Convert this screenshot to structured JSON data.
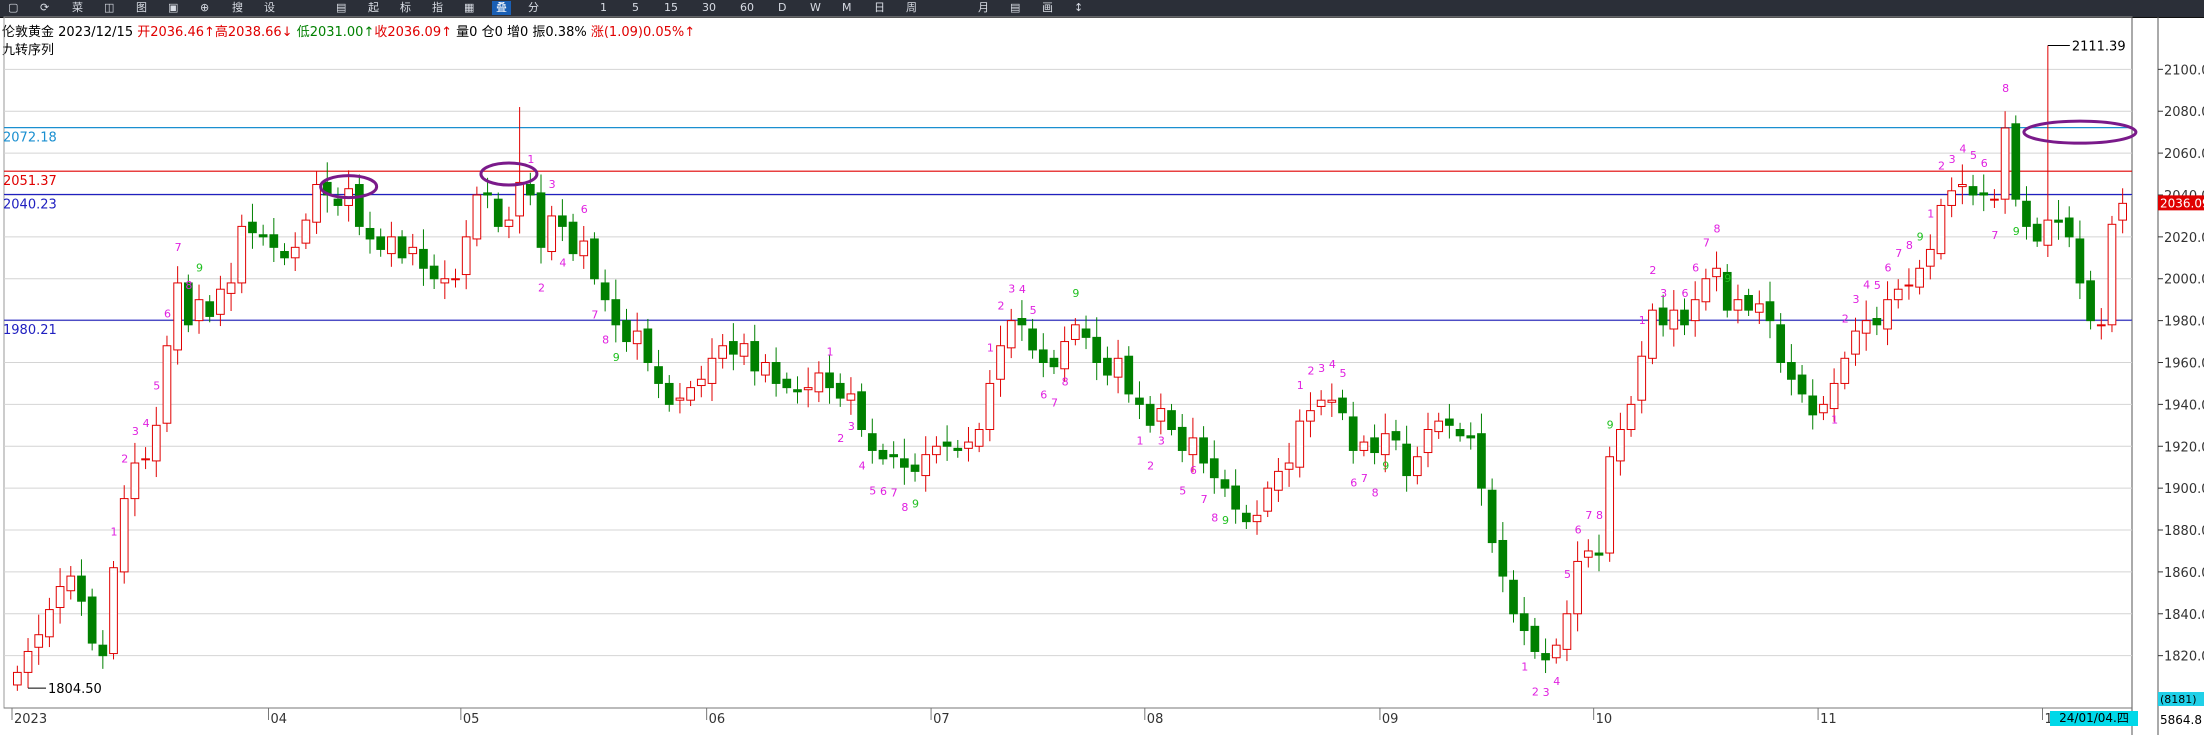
{
  "toolbar": {
    "items": [
      "▢",
      "⟳",
      "菜",
      "◫",
      "图",
      "▣",
      "⊕",
      "搜",
      "设",
      "▤",
      "起",
      "标",
      "指",
      "▦",
      "叠",
      "分",
      "1",
      "5",
      "15",
      "30",
      "60",
      "D",
      "W",
      "M",
      "日",
      "周",
      "月",
      "▤",
      "画",
      "↕"
    ]
  },
  "info": {
    "name": "伦敦黄金",
    "date": "2023/12/15",
    "open_label": "开2036.46↑",
    "high_label": "高2038.66↓",
    "low_label": "低2031.00↑",
    "close_label": "收2036.09↑",
    "vol_label": "量0",
    "oi_label": "仓0",
    "inc_label": "增0",
    "amp_label": "振0.38%",
    "chg_label": "涨(1.09)0.05%↑"
  },
  "indicator_name": "九转序列",
  "chart_data": {
    "type": "candlestick",
    "ylim": [
      1795,
      2125
    ],
    "y_ticks": [
      1820,
      1840,
      1860,
      1880,
      1900,
      1920,
      1940,
      1960,
      1980,
      2000,
      2020,
      2040,
      2060,
      2080,
      2100
    ],
    "x_labels": [
      "2023",
      "04",
      "05",
      "06",
      "07",
      "08",
      "09",
      "10",
      "11",
      "12"
    ],
    "x_label_index": [
      0,
      24,
      42,
      65,
      86,
      106,
      128,
      148,
      169,
      190
    ],
    "horizontal_lines": [
      {
        "label": "2072.18",
        "value": 2072.18,
        "color": "#1a8fd0"
      },
      {
        "label": "2051.37",
        "value": 2051.37,
        "color": "#e00000"
      },
      {
        "label": "2040.23",
        "value": 2040.23,
        "color": "#2020c0"
      },
      {
        "label": "1980.21",
        "value": 1980.21,
        "color": "#2020c0"
      }
    ],
    "current_price_label": "2036.09",
    "high_marker": {
      "label": "2111.39",
      "value": 2111.39,
      "index": 190
    },
    "low_marker": {
      "label": "1804.50",
      "value": 1804.5,
      "index": 1
    },
    "circles": [
      {
        "index": 31,
        "value": 2044
      },
      {
        "index": 46,
        "value": 2050
      },
      {
        "index": 193,
        "value": 2070
      }
    ],
    "close": [
      1812,
      1822,
      1830,
      1842,
      1853,
      1858,
      1846,
      1826,
      1820,
      1862,
      1895,
      1912,
      1914,
      1930,
      1968,
      1998,
      1978,
      1990,
      1982,
      1995,
      1998,
      2025,
      2022,
      2020,
      2015,
      2010,
      2015,
      2028,
      2045,
      2040,
      2035,
      2043,
      2025,
      2019,
      2014,
      2020,
      2010,
      2015,
      2005,
      2000,
      2000,
      2000,
      2020,
      2040,
      2040,
      2025,
      2028,
      2046,
      2040,
      2015,
      2030,
      2025,
      2012,
      2018,
      2000,
      1990,
      1978,
      1970,
      1975,
      1960,
      1950,
      1940,
      1943,
      1948,
      1952,
      1962,
      1968,
      1964,
      1969,
      1956,
      1960,
      1950,
      1948,
      1946,
      1948,
      1955,
      1948,
      1943,
      1945,
      1928,
      1918,
      1914,
      1915,
      1910,
      1908,
      1916,
      1920,
      1920,
      1918,
      1922,
      1928,
      1950,
      1968,
      1980,
      1978,
      1966,
      1960,
      1958,
      1970,
      1978,
      1972,
      1960,
      1954,
      1962,
      1945,
      1940,
      1930,
      1938,
      1928,
      1918,
      1924,
      1912,
      1905,
      1900,
      1890,
      1884,
      1887,
      1900,
      1908,
      1912,
      1932,
      1937,
      1942,
      1942,
      1936,
      1918,
      1922,
      1917,
      1926,
      1923,
      1906,
      1915,
      1928,
      1932,
      1930,
      1925,
      1924,
      1900,
      1874,
      1858,
      1840,
      1832,
      1822,
      1818,
      1825,
      1840,
      1865,
      1870,
      1868,
      1915,
      1928,
      1940,
      1963,
      1985,
      1978,
      1985,
      1978,
      1990,
      2000,
      2005,
      1985,
      1990,
      1985,
      1988,
      1980,
      1960,
      1952,
      1945,
      1935,
      1940,
      1950,
      1962,
      1975,
      1980,
      1978,
      1990,
      1995,
      1997,
      2005,
      2014,
      2035,
      2042,
      2045,
      2040,
      2040,
      2038,
      2072,
      2038,
      2025,
      2018,
      2028,
      2027,
      2020,
      1998,
      1980,
      1978,
      2026,
      2036
    ]
  },
  "td_counts": [
    {
      "t": "1",
      "i": 9,
      "c": "m"
    },
    {
      "t": "2",
      "i": 10,
      "c": "m"
    },
    {
      "t": "3",
      "i": 11,
      "c": "m"
    },
    {
      "t": "4",
      "i": 12,
      "c": "m"
    },
    {
      "t": "5",
      "i": 13,
      "c": "m"
    },
    {
      "t": "6",
      "i": 14,
      "c": "m"
    },
    {
      "t": "7",
      "i": 15,
      "c": "m"
    },
    {
      "t": "8",
      "i": 16,
      "c": "m"
    },
    {
      "t": "9",
      "i": 17,
      "c": "g"
    },
    {
      "t": "1",
      "i": 48,
      "c": "m"
    },
    {
      "t": "2",
      "i": 49,
      "c": "m"
    },
    {
      "t": "3",
      "i": 50,
      "c": "m"
    },
    {
      "t": "4",
      "i": 51,
      "c": "m"
    },
    {
      "t": "6",
      "i": 53,
      "c": "m"
    },
    {
      "t": "7",
      "i": 54,
      "c": "m"
    },
    {
      "t": "8",
      "i": 55,
      "c": "m"
    },
    {
      "t": "9",
      "i": 56,
      "c": "g"
    },
    {
      "t": "1",
      "i": 76,
      "c": "m"
    },
    {
      "t": "2",
      "i": 77,
      "c": "m"
    },
    {
      "t": "3",
      "i": 78,
      "c": "m"
    },
    {
      "t": "4",
      "i": 79,
      "c": "m"
    },
    {
      "t": "5",
      "i": 80,
      "c": "m"
    },
    {
      "t": "6",
      "i": 81,
      "c": "m"
    },
    {
      "t": "7",
      "i": 82,
      "c": "m"
    },
    {
      "t": "8",
      "i": 83,
      "c": "m"
    },
    {
      "t": "9",
      "i": 84,
      "c": "g"
    },
    {
      "t": "1",
      "i": 91,
      "c": "m"
    },
    {
      "t": "2",
      "i": 92,
      "c": "m"
    },
    {
      "t": "3",
      "i": 93,
      "c": "m"
    },
    {
      "t": "4",
      "i": 94,
      "c": "m"
    },
    {
      "t": "5",
      "i": 95,
      "c": "m"
    },
    {
      "t": "6",
      "i": 96,
      "c": "m"
    },
    {
      "t": "7",
      "i": 97,
      "c": "m"
    },
    {
      "t": "8",
      "i": 98,
      "c": "m"
    },
    {
      "t": "9",
      "i": 99,
      "c": "g"
    },
    {
      "t": "1",
      "i": 105,
      "c": "m"
    },
    {
      "t": "2",
      "i": 106,
      "c": "m"
    },
    {
      "t": "3",
      "i": 107,
      "c": "m"
    },
    {
      "t": "5",
      "i": 109,
      "c": "m"
    },
    {
      "t": "6",
      "i": 110,
      "c": "m"
    },
    {
      "t": "7",
      "i": 111,
      "c": "m"
    },
    {
      "t": "8",
      "i": 112,
      "c": "m"
    },
    {
      "t": "9",
      "i": 113,
      "c": "g"
    },
    {
      "t": "1",
      "i": 120,
      "c": "m"
    },
    {
      "t": "2",
      "i": 121,
      "c": "m"
    },
    {
      "t": "3",
      "i": 122,
      "c": "m"
    },
    {
      "t": "4",
      "i": 123,
      "c": "m"
    },
    {
      "t": "5",
      "i": 124,
      "c": "m"
    },
    {
      "t": "6",
      "i": 125,
      "c": "m"
    },
    {
      "t": "7",
      "i": 126,
      "c": "m"
    },
    {
      "t": "8",
      "i": 127,
      "c": "m"
    },
    {
      "t": "9",
      "i": 128,
      "c": "g"
    },
    {
      "t": "1",
      "i": 141,
      "c": "m"
    },
    {
      "t": "2",
      "i": 142,
      "c": "m"
    },
    {
      "t": "3",
      "i": 143,
      "c": "m"
    },
    {
      "t": "4",
      "i": 144,
      "c": "m"
    },
    {
      "t": "5",
      "i": 145,
      "c": "m"
    },
    {
      "t": "6",
      "i": 146,
      "c": "m"
    },
    {
      "t": "7",
      "i": 147,
      "c": "m"
    },
    {
      "t": "8",
      "i": 148,
      "c": "m"
    },
    {
      "t": "9",
      "i": 149,
      "c": "g"
    },
    {
      "t": "1",
      "i": 152,
      "c": "m"
    },
    {
      "t": "2",
      "i": 153,
      "c": "m"
    },
    {
      "t": "3",
      "i": 154,
      "c": "m"
    },
    {
      "t": "6",
      "i": 156,
      "c": "m"
    },
    {
      "t": "6",
      "i": 157,
      "c": "m"
    },
    {
      "t": "7",
      "i": 158,
      "c": "m"
    },
    {
      "t": "8",
      "i": 159,
      "c": "m"
    },
    {
      "t": "9",
      "i": 160,
      "c": "g"
    },
    {
      "t": "1",
      "i": 170,
      "c": "m"
    },
    {
      "t": "2",
      "i": 171,
      "c": "m"
    },
    {
      "t": "3",
      "i": 172,
      "c": "m"
    },
    {
      "t": "4",
      "i": 173,
      "c": "m"
    },
    {
      "t": "5",
      "i": 174,
      "c": "m"
    },
    {
      "t": "6",
      "i": 175,
      "c": "m"
    },
    {
      "t": "7",
      "i": 176,
      "c": "m"
    },
    {
      "t": "8",
      "i": 177,
      "c": "m"
    },
    {
      "t": "9",
      "i": 178,
      "c": "g"
    },
    {
      "t": "1",
      "i": 179,
      "c": "m"
    },
    {
      "t": "2",
      "i": 180,
      "c": "m"
    },
    {
      "t": "3",
      "i": 181,
      "c": "m"
    },
    {
      "t": "4",
      "i": 182,
      "c": "m"
    },
    {
      "t": "5",
      "i": 183,
      "c": "m"
    },
    {
      "t": "6",
      "i": 184,
      "c": "m"
    },
    {
      "t": "7",
      "i": 185,
      "c": "m"
    },
    {
      "t": "8",
      "i": 186,
      "c": "m"
    },
    {
      "t": "9",
      "i": 187,
      "c": "g"
    }
  ],
  "right_panel": {
    "vol_count": "(8181)",
    "vol_value": "5864.8"
  },
  "date_badge": "24/01/04.四",
  "colors": {
    "up": "#e00000",
    "down": "#008000",
    "grid": "#d4d4d4",
    "td_magenta": "#e020e0",
    "td_green": "#20c020",
    "circle": "#7a1a8a",
    "price_badge": "#e00000"
  }
}
